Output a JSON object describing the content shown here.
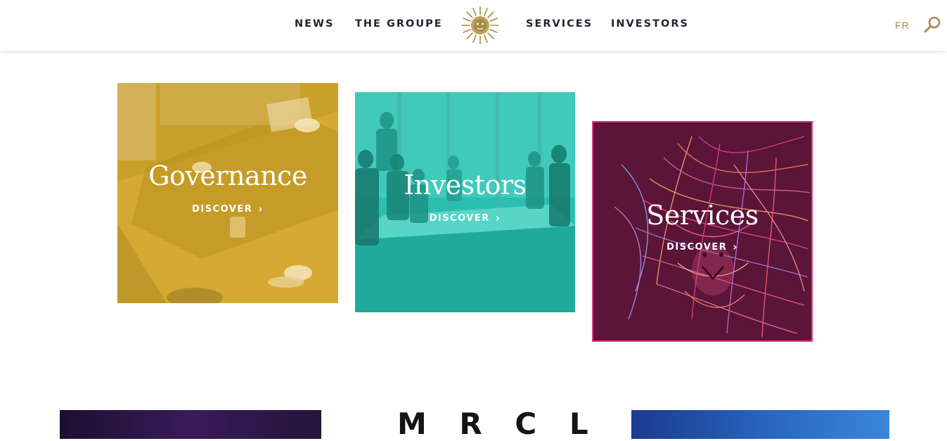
{
  "header": {
    "nav_left": [
      {
        "label": "NEWS"
      },
      {
        "label": "THE GROUPE"
      }
    ],
    "nav_right": [
      {
        "label": "SERVICES"
      },
      {
        "label": "INVESTORS"
      }
    ],
    "logo_icon": "lion-sun-logo-icon",
    "lang_label": "FR",
    "search_icon": "search-icon"
  },
  "cards": [
    {
      "title": "Governance",
      "cta": "DISCOVER",
      "color": "#c9a02a"
    },
    {
      "title": "Investors",
      "cta": "DISCOVER",
      "color": "#2bbfae"
    },
    {
      "title": "Services",
      "cta": "DISCOVER",
      "color": "#5a1538",
      "border": "#e0377f"
    }
  ],
  "bottom": {
    "brand_text": "M R C L"
  },
  "colors": {
    "nav_text": "#1f2430",
    "gold": "#a68a4c"
  }
}
